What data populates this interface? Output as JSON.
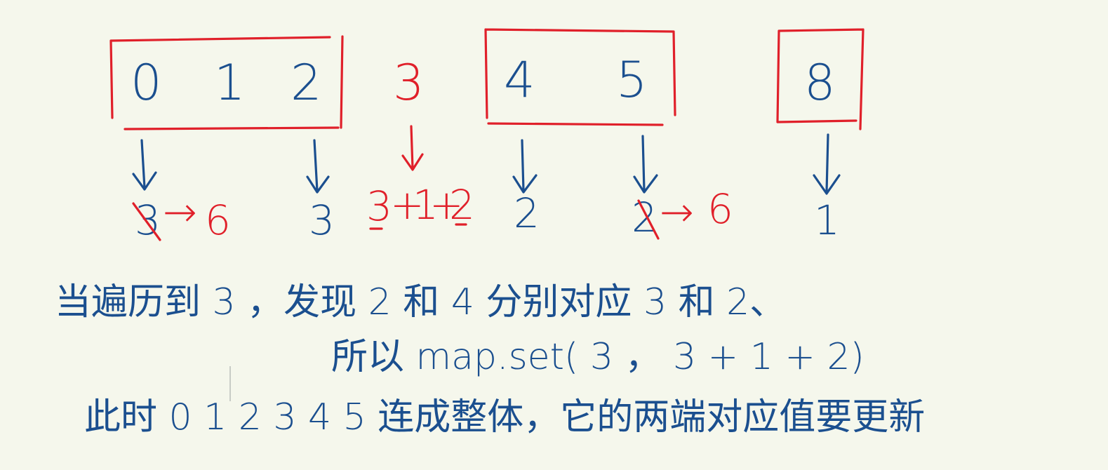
{
  "colors": {
    "background": "#f5f7ec",
    "ink_blue": "#1b4f8f",
    "ink_red": "#e0202a"
  },
  "top_row": {
    "group1": [
      "0",
      "1",
      "2"
    ],
    "middle": "3",
    "group2": [
      "4",
      "5"
    ],
    "group3": [
      "8"
    ]
  },
  "values_row": {
    "v0_old": "3",
    "v0_arrow": "→",
    "v0_new": "6",
    "v2": "3",
    "v3_a": "3",
    "v3_plus1": "+",
    "v3_b": "1",
    "v3_plus2": "+",
    "v3_c": "2",
    "v4": "2",
    "v5_old": "2",
    "v5_arrow": "→",
    "v5_new": "6",
    "v8": "1"
  },
  "notes": {
    "line1": "当遍历到 3 ，发现 2 和 4 分别对应 3 和 2、",
    "line2": "所以 map.set( 3 ， 3 + 1 + 2)",
    "line3": "此时 0 1 2 3 4 5 连成整体，它的两端对应值要更新"
  }
}
